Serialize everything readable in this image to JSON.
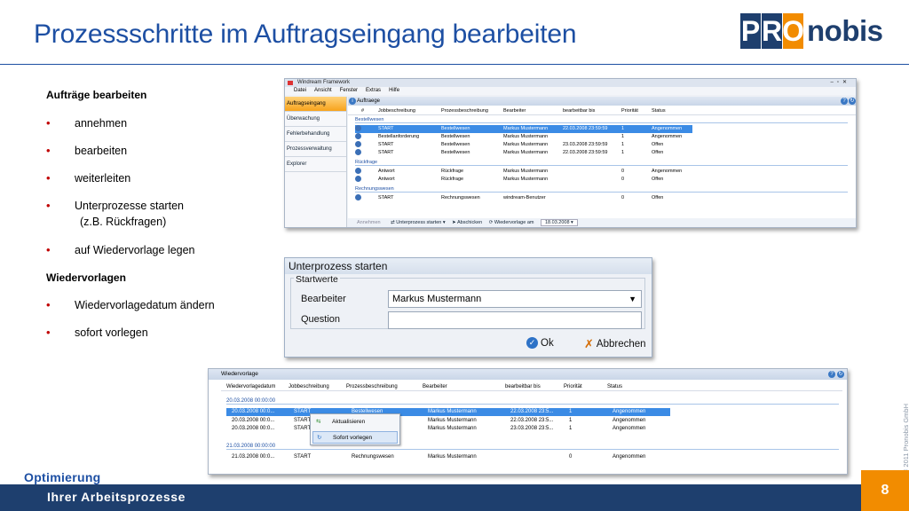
{
  "title": "Prozessschritte im Auftragseingang bearbeiten",
  "logo": {
    "letters": [
      "P",
      "R",
      "O"
    ],
    "text": "nobis"
  },
  "left": {
    "heading1": "Aufträge bearbeiten",
    "bullets1": [
      "annehmen",
      "bearbeiten",
      "weiterleiten",
      "Unterprozesse starten",
      "(z.B. Rückfragen)",
      "auf Wiedervorlage legen"
    ],
    "heading2": "Wiedervorlagen",
    "bullets2": [
      "Wiedervorlagedatum ändern",
      "sofort vorlegen"
    ],
    "bullet_symbol": "•"
  },
  "fw": {
    "window_title": "Windream Framework",
    "menu": [
      "Datei",
      "Ansicht",
      "Fenster",
      "Extras",
      "Hilfe"
    ],
    "nav": [
      "Auftragseingang",
      "Überwachung",
      "Fehlerbehandlung",
      "Prozessverwaltung",
      "Explorer"
    ],
    "panel_title": "Auftraege",
    "columns": [
      "#",
      "Jobbeschreibung",
      "Prozessbeschreibung",
      "Bearbeiter",
      "bearbeitbar bis",
      "Priorität",
      "Status"
    ],
    "groups": [
      {
        "name": "Bestellwesen",
        "rows": [
          [
            "",
            "START",
            "Bestellwesen",
            "Markus Mustermann",
            "22.03.2008 23:59:59",
            "1",
            "Angenommen"
          ],
          [
            "",
            "Bestellanforderung",
            "Bestellwesen",
            "Markus Mustermann",
            "",
            "1",
            "Angenommen"
          ],
          [
            "",
            "START",
            "Bestellwesen",
            "Markus Mustermann",
            "23.03.2008 23:59:59",
            "1",
            "Offen"
          ],
          [
            "",
            "START",
            "Bestellwesen",
            "Markus Mustermann",
            "22.03.2008 23:59:59",
            "1",
            "Offen"
          ]
        ]
      },
      {
        "name": "Rückfrage",
        "rows": [
          [
            "",
            "Antwort",
            "Rückfrage",
            "Markus Mustermann",
            "",
            "0",
            "Angenommen"
          ],
          [
            "",
            "Antwort",
            "Rückfrage",
            "Markus Mustermann",
            "",
            "0",
            "Offen"
          ]
        ]
      },
      {
        "name": "Rechnungswesen",
        "rows": [
          [
            "",
            "START",
            "Rechnungswesen",
            "windream-Benutzer",
            "",
            "0",
            "Offen"
          ]
        ]
      }
    ],
    "toolbar": [
      "Annehmen",
      "Unterprozess starten",
      "Abschicken",
      "Wiedervorlage am",
      "18.03.2008"
    ]
  },
  "dialog": {
    "title": "Unterprozess starten",
    "group": "Startwerte",
    "label1": "Bearbeiter",
    "value1": "Markus Mustermann",
    "label2": "Question",
    "value2": "",
    "ok": "Ok",
    "cancel": "Abbrechen"
  },
  "wv": {
    "title": "Wiedervorlage",
    "columns": [
      "Wiedervorlagedatum",
      "Jobbeschreibung",
      "Prozessbeschreibung",
      "Bearbeiter",
      "bearbeitbar bis",
      "Priorität",
      "Status"
    ],
    "group1": "20.03.2008 00:00:00",
    "rows1": [
      [
        "20.03.2008 00:0...",
        "START",
        "Bestellwesen",
        "Markus Mustermann",
        "22.03.2008 23:5...",
        "1",
        "Angenommen"
      ],
      [
        "20.03.2008 00:0...",
        "START",
        "",
        "Markus Mustermann",
        "22.03.2008 23:5...",
        "1",
        "Angenommen"
      ],
      [
        "20.03.2008 00:0...",
        "START",
        "",
        "Markus Mustermann",
        "23.03.2008 23:5...",
        "1",
        "Angenommen"
      ]
    ],
    "group2": "21.03.2008 00:00:00",
    "rows2": [
      [
        "21.03.2008 00:0...",
        "START",
        "Rechnungswesen",
        "Markus Mustermann",
        "",
        "0",
        "Angenommen"
      ]
    ],
    "context_menu": [
      "Aktualisieren",
      "Sofort vorlegen"
    ]
  },
  "copyright": "© 2011 Pronobis GmbH",
  "footer": {
    "line1": "Optimierung",
    "line2": "Ihrer Arbeitsprozesse",
    "page": "8"
  },
  "colors": {
    "brand_blue": "#1e3f6e",
    "title_blue": "#1d4fa3",
    "accent_orange": "#f28c00",
    "bullet_red": "#c00000",
    "selection": "#3b8be5"
  }
}
